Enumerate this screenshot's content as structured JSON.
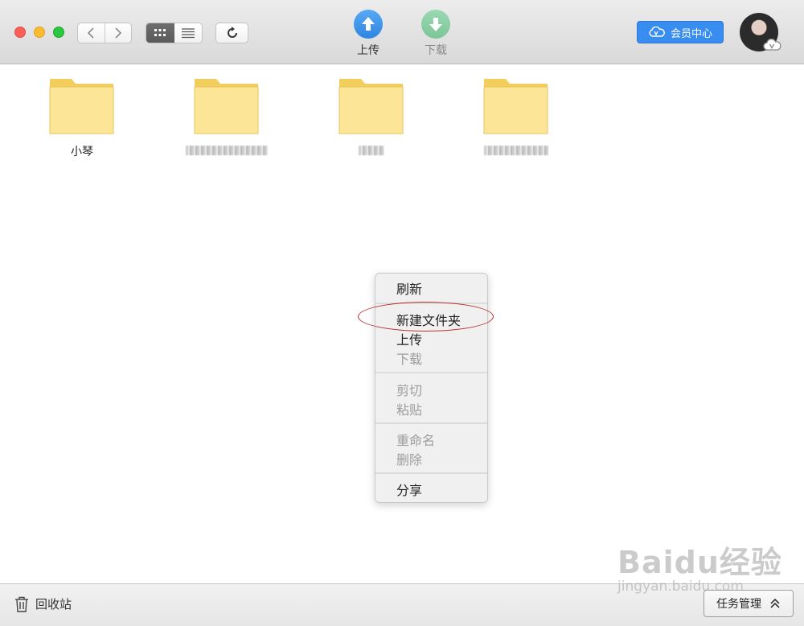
{
  "toolbar": {
    "upload_label": "上传",
    "download_label": "下载",
    "vip_label": "会员中心"
  },
  "folders": [
    {
      "name": "小琴",
      "obscured": false
    },
    {
      "name": "",
      "obscured": true
    },
    {
      "name": "",
      "obscured": true
    },
    {
      "name": "",
      "obscured": true
    }
  ],
  "context_menu": {
    "items": [
      {
        "label": "刷新",
        "enabled": true
      },
      {
        "label": "新建文件夹",
        "enabled": true,
        "highlighted": true
      },
      {
        "label": "上传",
        "enabled": true
      },
      {
        "label": "下载",
        "enabled": false
      },
      {
        "label": "剪切",
        "enabled": false
      },
      {
        "label": "粘贴",
        "enabled": false
      },
      {
        "label": "重命名",
        "enabled": false
      },
      {
        "label": "删除",
        "enabled": false
      },
      {
        "label": "分享",
        "enabled": true
      }
    ]
  },
  "bottombar": {
    "trash_label": "回收站",
    "task_label": "任务管理"
  },
  "watermark": {
    "line1": "Baidu经验",
    "line2": "jingyan.baidu.com"
  },
  "colors": {
    "accent": "#3a8df0",
    "folder": "#fde597",
    "highlight_ring": "#b83030"
  },
  "icons": [
    "chevron-left-icon",
    "chevron-right-icon",
    "grid-view-icon",
    "list-view-icon",
    "refresh-icon",
    "upload-icon",
    "download-icon",
    "cloud-vip-icon",
    "trash-icon",
    "chevron-up-icon"
  ]
}
